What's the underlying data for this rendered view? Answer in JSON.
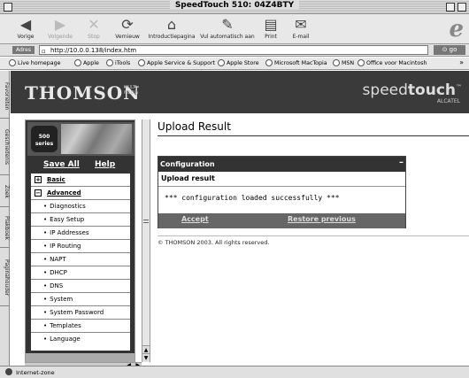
{
  "window": {
    "title": "SpeedTouch 510: 04Z4BTY"
  },
  "toolbar": {
    "buttons": [
      {
        "label": "Vorige",
        "icon": "back-arrow-icon"
      },
      {
        "label": "Volgende",
        "icon": "forward-arrow-icon"
      },
      {
        "label": "Stop",
        "icon": "stop-x-icon"
      },
      {
        "label": "Vernieuw",
        "icon": "refresh-icon"
      },
      {
        "label": "Introductiepagina",
        "icon": "home-icon"
      },
      {
        "label": "Vul automatisch aan",
        "icon": "autofill-icon"
      },
      {
        "label": "Print",
        "icon": "print-icon"
      },
      {
        "label": "E-mail",
        "icon": "mail-icon"
      }
    ]
  },
  "address": {
    "label": "Adres",
    "url": "http://10.0.0.138/index.htm",
    "go": "go"
  },
  "favorites": [
    "Live homepage",
    "Apple",
    "iTools",
    "Apple Service & Support",
    "Apple Store",
    "Microsoft MacTopia",
    "MSN",
    "Office voor Macintosh"
  ],
  "side_tabs": [
    "Favorieten",
    "Geschiedenis",
    "Zoek",
    "Plakboek",
    "Paginahouder"
  ],
  "banner": {
    "brand": "THOMSON",
    "brand_sub": "MULTI MEDIA",
    "product_light": "speed",
    "product_bold": "touch",
    "product_mark": "™",
    "maker": "ALCATEL"
  },
  "sidebar": {
    "series_line1": "500",
    "series_line2": "series",
    "save_all": "Save All",
    "help": "Help",
    "menu": [
      {
        "label": "Basic",
        "kind": "top",
        "box": "+"
      },
      {
        "label": "Advanced",
        "kind": "top",
        "box": "−"
      },
      {
        "label": "Diagnostics",
        "kind": "sub"
      },
      {
        "label": "Easy Setup",
        "kind": "sub"
      },
      {
        "label": "IP Addresses",
        "kind": "sub"
      },
      {
        "label": "IP Routing",
        "kind": "sub"
      },
      {
        "label": "NAPT",
        "kind": "sub"
      },
      {
        "label": "DHCP",
        "kind": "sub"
      },
      {
        "label": "DNS",
        "kind": "sub"
      },
      {
        "label": "System",
        "kind": "sub"
      },
      {
        "label": "System Password",
        "kind": "sub"
      },
      {
        "label": "Templates",
        "kind": "sub"
      },
      {
        "label": "Language",
        "kind": "sub"
      }
    ]
  },
  "main": {
    "title": "Upload Result",
    "panel": {
      "header": "Configuration",
      "minimize": "–",
      "subtitle": "Upload result",
      "message": "*** configuration loaded successfully ***",
      "accept": "Accept",
      "restore": "Restore previous"
    },
    "copyright": "© THOMSON 2003. All rights reserved."
  },
  "status": {
    "text": "Internet-zone"
  }
}
